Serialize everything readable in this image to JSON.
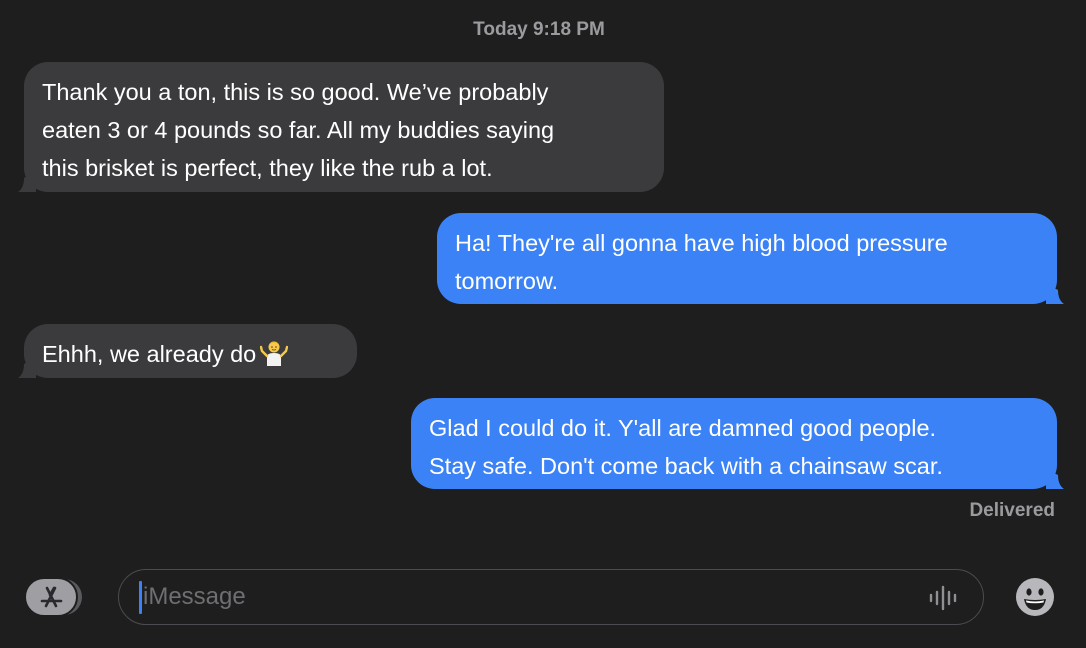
{
  "conversation": {
    "timestamp": "Today 9:18 PM",
    "messages": [
      {
        "direction": "received",
        "lines": [
          "Thank you a ton, this is so good. We’ve probably",
          "eaten 3 or 4 pounds so far. All my buddies saying",
          "this brisket is perfect, they like the rub a lot."
        ]
      },
      {
        "direction": "sent",
        "lines": [
          "Ha!  They're all gonna have high blood pressure",
          "tomorrow."
        ]
      },
      {
        "direction": "received",
        "lines": [
          "Ehhh, we already do"
        ],
        "emoji_icon": "person-shrugging-emoji"
      },
      {
        "direction": "sent",
        "lines": [
          "Glad I could do it.  Y'all are damned good people.",
          "Stay safe.  Don't come back with a chainsaw scar."
        ]
      }
    ],
    "delivery_status": "Delivered"
  },
  "composer": {
    "placeholder": "iMessage",
    "value": "",
    "apps_icon": "app-store-icon",
    "audio_icon": "waveform-icon",
    "emoji_icon": "smiley-face-icon"
  },
  "colors": {
    "background": "#1e1e1e",
    "received_bubble": "#3b3b3d",
    "sent_bubble": "#3b82f6",
    "secondary_text": "#9b9b9f",
    "caret": "#3b82f6"
  }
}
